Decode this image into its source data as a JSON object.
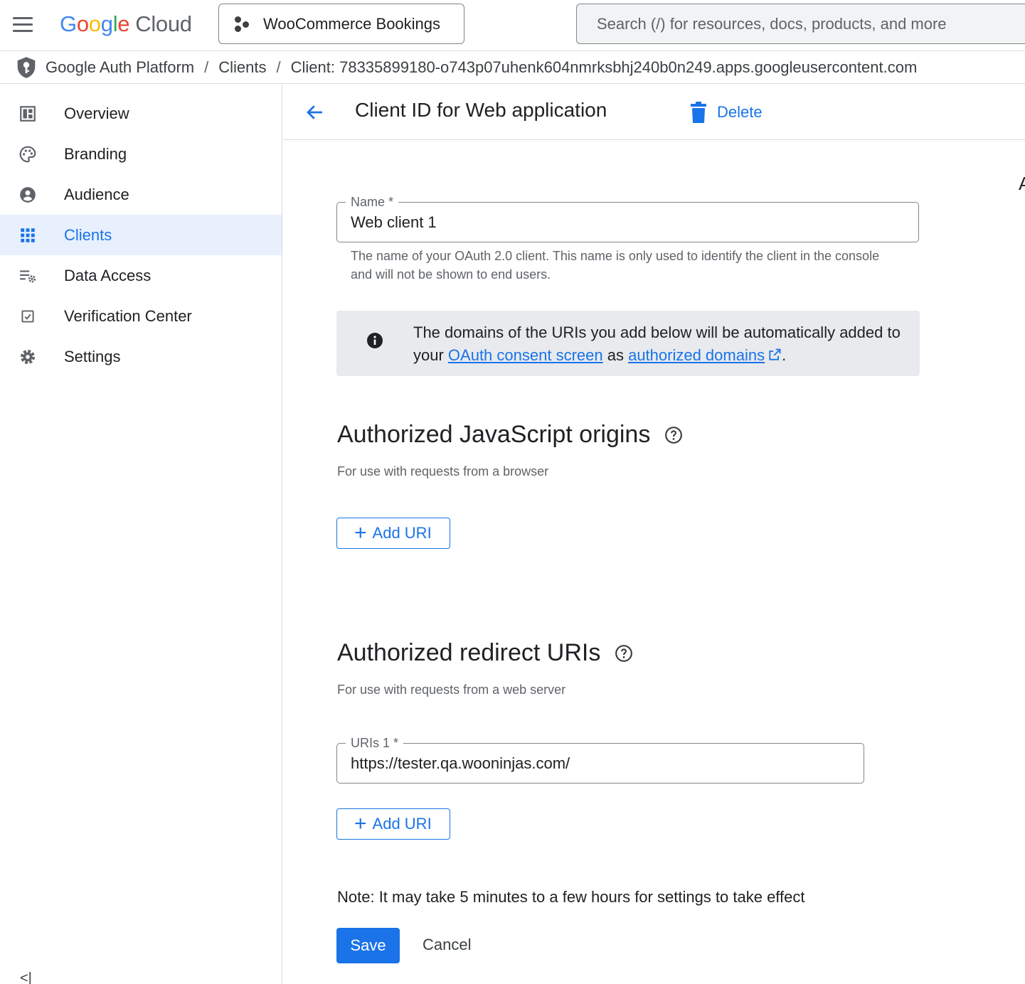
{
  "topbar": {
    "logo_google": "Google",
    "logo_cloud": "Cloud",
    "project_name": "WooCommerce Bookings",
    "search_placeholder": "Search (/) for resources, docs, products, and more"
  },
  "breadcrumb": {
    "items": [
      "Google Auth Platform",
      "Clients",
      "Client: 78335899180-o743p07uhenk604nmrksbhj240b0n249.apps.googleusercontent.com"
    ],
    "separator": "/"
  },
  "sidebar": {
    "items": [
      {
        "label": "Overview",
        "icon": "dashboard-icon",
        "active": false
      },
      {
        "label": "Branding",
        "icon": "palette-icon",
        "active": false
      },
      {
        "label": "Audience",
        "icon": "account-circle-icon",
        "active": false
      },
      {
        "label": "Clients",
        "icon": "apps-grid-icon",
        "active": true
      },
      {
        "label": "Data Access",
        "icon": "list-settings-icon",
        "active": false
      },
      {
        "label": "Verification Center",
        "icon": "checkbox-icon",
        "active": false
      },
      {
        "label": "Settings",
        "icon": "gear-icon",
        "active": false
      }
    ],
    "collapse_label": "<|"
  },
  "header": {
    "title": "Client ID for Web application",
    "delete_label": "Delete",
    "edge_text": "A"
  },
  "form": {
    "name_label": "Name *",
    "name_value": "Web client 1",
    "name_hint": "The name of your OAuth 2.0 client. This name is only used to identify the client in the console and will not be shown to end users.",
    "info": {
      "text_before": "The domains of the URIs you add below will be automatically added to your ",
      "link1": "OAuth consent screen",
      "text_middle": " as ",
      "link2": "authorized domains",
      "text_after": "."
    },
    "js_origins": {
      "title": "Authorized JavaScript origins",
      "subtitle": "For use with requests from a browser",
      "add_label": "Add URI"
    },
    "redirect_uris": {
      "title": "Authorized redirect URIs",
      "subtitle": "For use with requests from a web server",
      "uri_label": "URIs 1 *",
      "uri_value": "https://tester.qa.wooninjas.com/",
      "add_label": "Add URI"
    },
    "note": "Note: It may take 5 minutes to a few hours for settings to take effect",
    "save_label": "Save",
    "cancel_label": "Cancel"
  },
  "colors": {
    "accent": "#1a73e8",
    "active_nav_bg": "#e8f0fe",
    "info_bg": "#e8eaed"
  }
}
